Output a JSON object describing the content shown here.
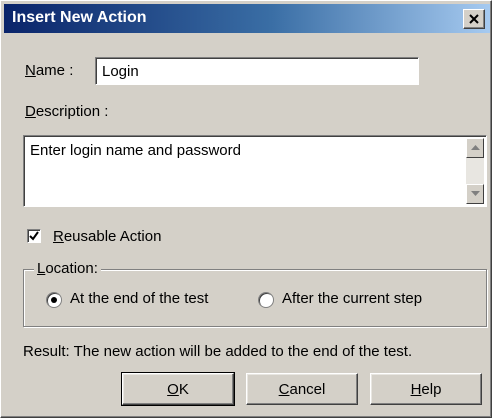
{
  "window": {
    "title": "Insert New Action",
    "close_glyph": "✕"
  },
  "name_field": {
    "label_prefix": "N",
    "label_rest": "ame :",
    "value": "Login"
  },
  "description_field": {
    "label_prefix": "D",
    "label_rest": "escription :",
    "value": "Enter login name and password"
  },
  "reusable_checkbox": {
    "checked": true,
    "label_prefix": "R",
    "label_rest": "eusable Action"
  },
  "location_group": {
    "legend_prefix": "L",
    "legend_rest": "ocation:",
    "options": [
      {
        "label": "At the end of the test",
        "selected": true
      },
      {
        "label": "After the current step",
        "selected": false
      }
    ]
  },
  "result_text": "Result: The new action will be added to the end of the test.",
  "buttons": {
    "ok_prefix": "O",
    "ok_rest": "K",
    "cancel_prefix": "C",
    "cancel_rest": "ancel",
    "help_prefix": "H",
    "help_rest": "elp"
  },
  "icons": {
    "close": "close-icon",
    "scroll_up": "arrow-up-icon",
    "scroll_down": "arrow-down-icon",
    "check": "checkmark-icon"
  },
  "colors": {
    "titlebar_start": "#0a246a",
    "titlebar_end": "#a6caf0",
    "face": "#d4d0c8"
  }
}
